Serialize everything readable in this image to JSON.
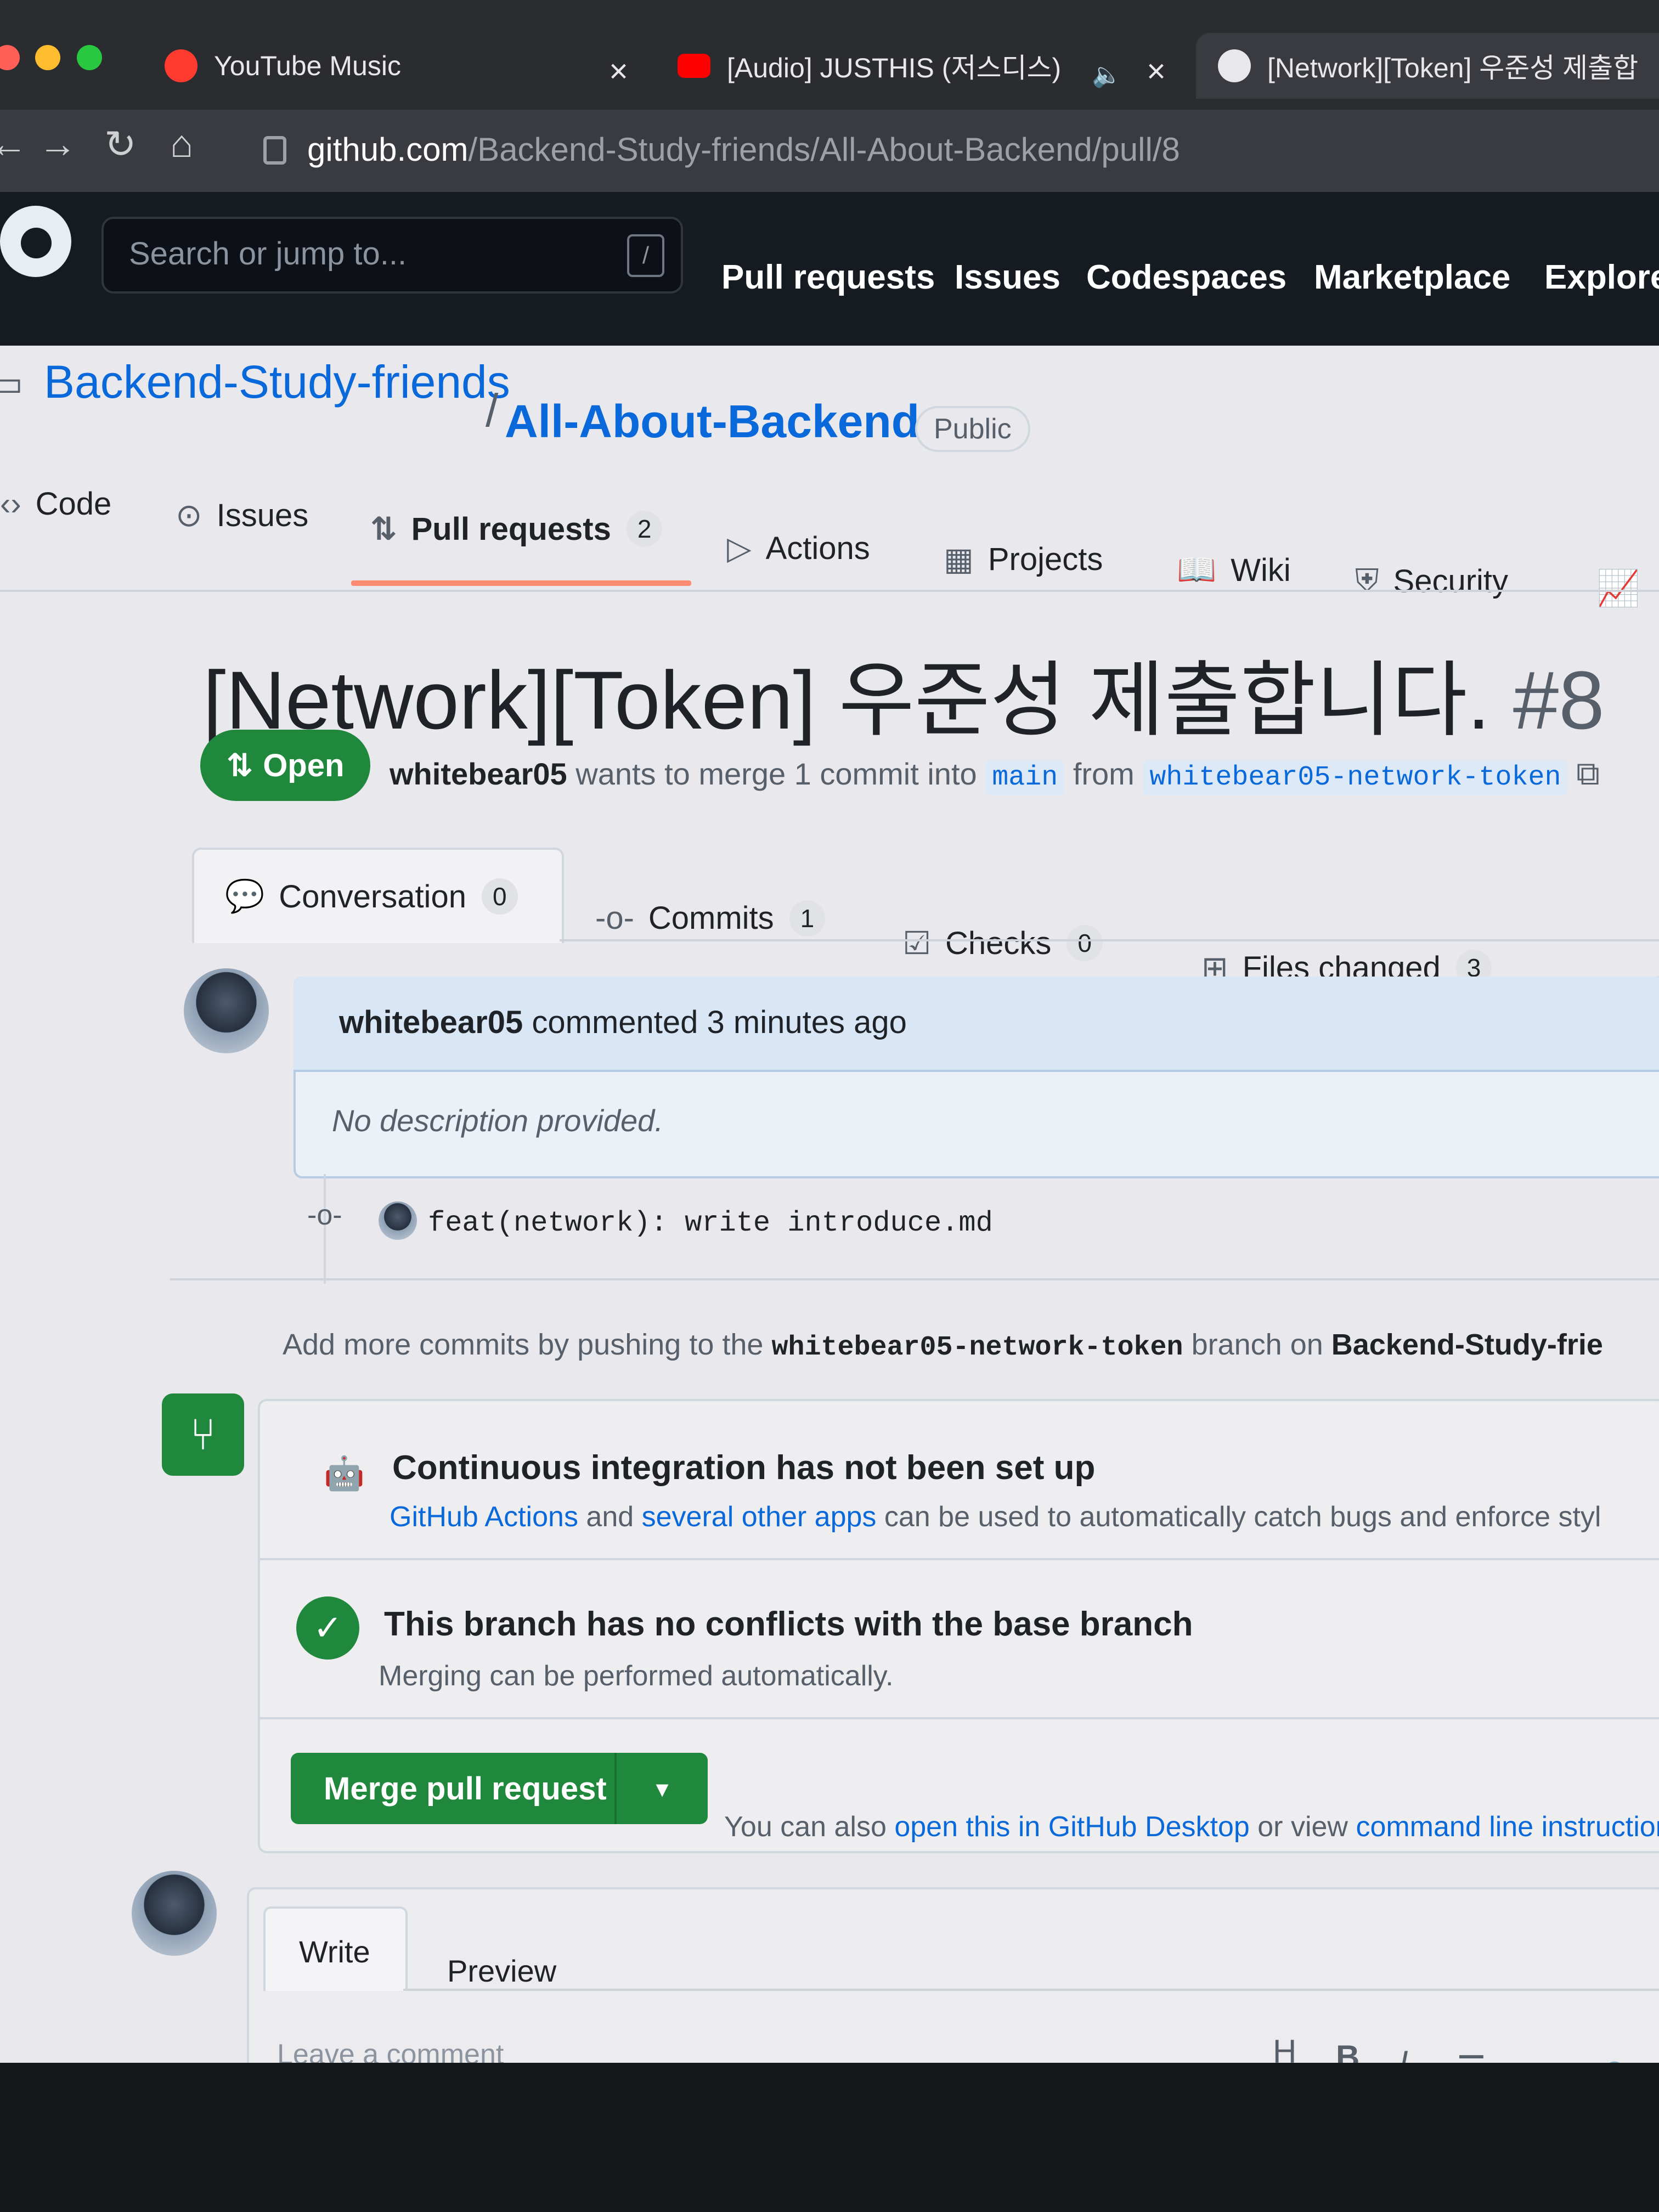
{
  "browser": {
    "tabs": [
      {
        "label": "YouTube Music"
      },
      {
        "label": "[Audio] JUSTHIS (저스디스)"
      },
      {
        "label": "[Network][Token] 우준성 제출합"
      }
    ],
    "url_host": "github.com",
    "url_path": "/Backend-Study-friends/All-About-Backend/pull/8"
  },
  "header": {
    "search_placeholder": "Search or jump to...",
    "search_key": "/",
    "nav": [
      "Pull requests",
      "Issues",
      "Codespaces",
      "Marketplace",
      "Explore"
    ]
  },
  "repo": {
    "owner": "Backend-Study-friends",
    "separator": "/",
    "name": "All-About-Backend",
    "visibility": "Public",
    "tabs": [
      {
        "label": "Code",
        "icon": "code-icon"
      },
      {
        "label": "Issues",
        "icon": "issue-icon"
      },
      {
        "label": "Pull requests",
        "icon": "pull-request-icon",
        "count": "2"
      },
      {
        "label": "Actions",
        "icon": "play-icon"
      },
      {
        "label": "Projects",
        "icon": "table-icon"
      },
      {
        "label": "Wiki",
        "icon": "book-icon"
      },
      {
        "label": "Security",
        "icon": "shield-icon"
      }
    ]
  },
  "pr": {
    "title": "[Network][Token] 우준성 제출합니다.",
    "number": "#8",
    "state": "Open",
    "author": "whitebear05",
    "merge_text": "wants to merge 1 commit into",
    "base": "main",
    "from_word": "from",
    "head": "whitebear05-network-token",
    "tabs": [
      {
        "label": "Conversation",
        "count": "0"
      },
      {
        "label": "Commits",
        "count": "1"
      },
      {
        "label": "Checks",
        "count": "0"
      },
      {
        "label": "Files changed",
        "count": "3"
      }
    ]
  },
  "comment": {
    "author": "whitebear05",
    "meta": "commented 3 minutes ago",
    "body": "No description provided."
  },
  "commit": {
    "message": "feat(network): write introduce.md"
  },
  "add_commits": {
    "prefix": "Add more commits by pushing to the",
    "branch": "whitebear05-network-token",
    "middle": "branch on",
    "repo": "Backend-Study-frie"
  },
  "merge": {
    "ci_title": "Continuous integration has not been set up",
    "ci_link1": "GitHub Actions",
    "ci_and": "and",
    "ci_link2": "several other apps",
    "ci_rest": "can be used to automatically catch bugs and enforce styl",
    "nc_title": "This branch has no conflicts with the base branch",
    "nc_sub": "Merging can be performed automatically.",
    "button": "Merge pull request",
    "also_prefix": "You can also",
    "also_link1": "open this in GitHub Desktop",
    "also_mid": "or view",
    "also_link2": "command line instructions"
  },
  "composer": {
    "tabs": [
      "Write",
      "Preview"
    ],
    "placeholder": "Leave a comment",
    "tools": [
      "H",
      "B",
      "I",
      "☰",
      "<>",
      "🔗"
    ]
  },
  "colors": {
    "accent": "#0969da",
    "success": "#1f883d",
    "tab_underline": "#fd8c73"
  }
}
